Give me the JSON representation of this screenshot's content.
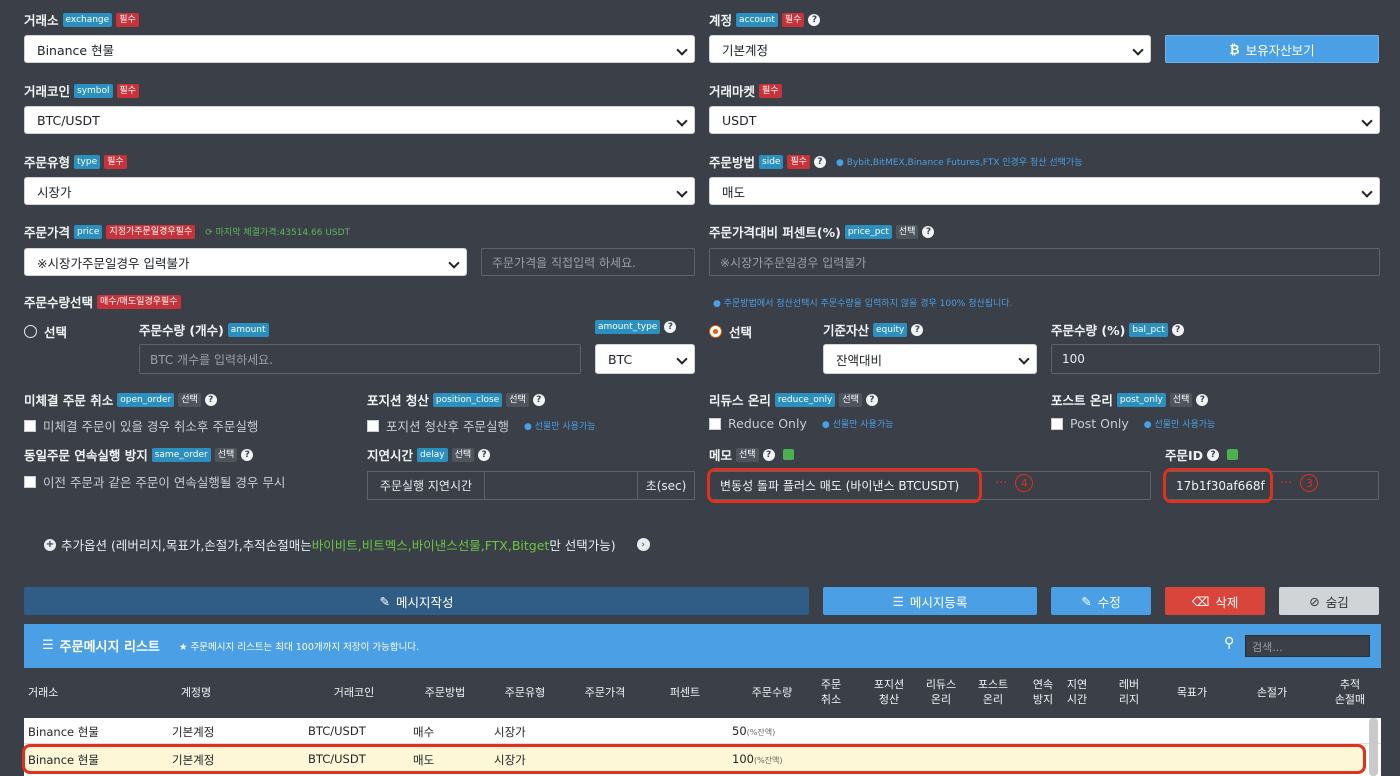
{
  "exchange": {
    "label": "거래소",
    "tag": "exchange",
    "req": "필수",
    "value": "Binance 현물"
  },
  "account": {
    "label": "계정",
    "tag": "account",
    "req": "필수",
    "value": "기본계정",
    "btn": "보유자산보기"
  },
  "symbol": {
    "label": "거래코인",
    "tag": "symbol",
    "req": "필수",
    "value": "BTC/USDT"
  },
  "market": {
    "label": "거래마켓",
    "req": "필수",
    "value": "USDT"
  },
  "type": {
    "label": "주문유형",
    "tag": "type",
    "req": "필수",
    "value": "시장가"
  },
  "side": {
    "label": "주문방법",
    "tag": "side",
    "req": "필수",
    "info": "Bybit,BitMEX,Binance Futures,FTX 인경우 청산 선택가능",
    "value": "매도"
  },
  "price": {
    "label": "주문가격",
    "tag": "price",
    "req": "지정가주문일경우필수",
    "last": "마지막 체결가격:43514.66 USDT",
    "value": "※시장가주문일경우 입력불가",
    "placeholder": "주문가격을 직접입력 하세요."
  },
  "price_pct": {
    "label": "주문가격대비 퍼센트(%)",
    "tag": "price_pct",
    "opt": "선택",
    "value": "※시장가주문일경우 입력불가"
  },
  "qty_select": {
    "label": "주문수량선택",
    "req": "매수/매도일경우필수",
    "info": "주문방법에서 청산선택시 주문수량을 입력하지 않을 경우 100% 청산됩니다."
  },
  "amount": {
    "radio": "선택",
    "label": "주문수량 (개수)",
    "tag": "amount",
    "placeholder": "BTC 개수를 입력하세요.",
    "type_tag": "amount_type",
    "type_value": "BTC"
  },
  "equity": {
    "radio": "선택",
    "label": "기준자산",
    "tag": "equity",
    "value": "잔액대비",
    "pct_label": "주문수량 (%)",
    "pct_tag": "bal_pct",
    "pct_value": "100"
  },
  "open_order": {
    "label": "미체결 주문 취소",
    "tag": "open_order",
    "opt": "선택",
    "check": "미체결 주문이 있을 경우 취소후 주문실행"
  },
  "position_close": {
    "label": "포지션 청산",
    "tag": "position_close",
    "opt": "선택",
    "check": "포지션 청산후 주문실행",
    "info": "선물만 사용가능"
  },
  "reduce_only": {
    "label": "리듀스 온리",
    "tag": "reduce_only",
    "opt": "선택",
    "check": "Reduce Only",
    "info": "선물만 사용가능"
  },
  "post_only": {
    "label": "포스트 온리",
    "tag": "post_only",
    "opt": "선택",
    "check": "Post Only",
    "info": "선물만 사용가능"
  },
  "same_order": {
    "label": "동일주문 연속실행 방지",
    "tag": "same_order",
    "opt": "선택",
    "check": "이전 주문과 같은 주문이 연속실행될 경우 무시"
  },
  "delay": {
    "label": "지연시간",
    "tag": "delay",
    "opt": "선택",
    "prefix": "주문실행 지연시간",
    "suffix": "초(sec)"
  },
  "memo": {
    "label": "메모",
    "opt": "선택",
    "value": "변동성 돌파 플러스 매도 (바이낸스 BTCUSDT)",
    "dots": "···",
    "num": "4"
  },
  "order_id": {
    "label": "주문ID",
    "value": "17b1f30af668f",
    "dots": "···",
    "num": "3"
  },
  "extra": {
    "text1": "추가옵션 (레버리지,목표가,손절가,추적손절매는 ",
    "text2": "바이비트,비트멕스,바이낸스선물,FTX,Bitget",
    "text3": "만 선택가능)"
  },
  "buttons": {
    "write": "메시지작성",
    "register": "메시지등록",
    "edit": "수정",
    "delete": "삭제",
    "hide": "숨김"
  },
  "list": {
    "title": "주문메시지 리스트",
    "note": "주문메시지 리스트는 최대 100개까지 저장이 가능합니다.",
    "search": "검색..."
  },
  "columns": [
    "거래소",
    "계정명",
    "거래코인",
    "주문방법",
    "주문유형",
    "주문가격",
    "퍼센트",
    "주문수량",
    "주문\n취소",
    "포지션\n청산",
    "리듀스\n온리",
    "포스트\n온리",
    "연속\n방지",
    "지연\n시간",
    "레버\n리지",
    "목표가",
    "손절가",
    "추적\n손절매"
  ],
  "rows": [
    {
      "exchange": "Binance 현물",
      "account": "기본계정",
      "symbol": "BTC/USDT",
      "side": "매수",
      "type": "시장가",
      "qty": "50",
      "qty_unit": "(%잔액)"
    },
    {
      "exchange": "Binance 현물",
      "account": "기본계정",
      "symbol": "BTC/USDT",
      "side": "매도",
      "type": "시장가",
      "qty": "100",
      "qty_unit": "(%잔액)"
    }
  ]
}
